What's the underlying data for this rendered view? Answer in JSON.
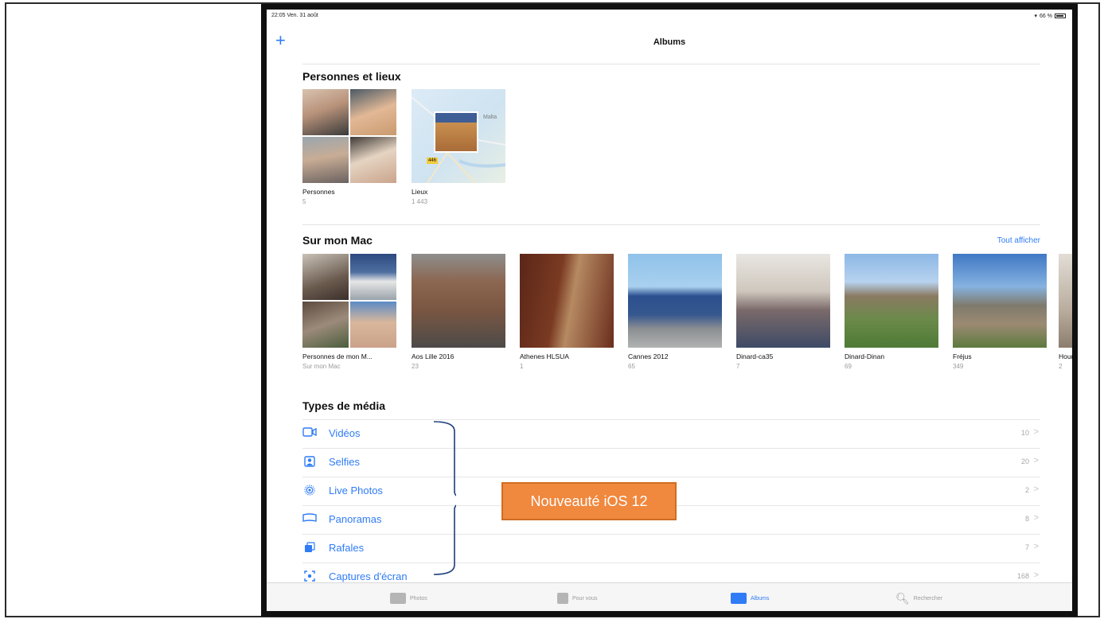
{
  "status_bar": {
    "time": "22:05  Ven. 31 août",
    "battery": "66 %"
  },
  "nav": {
    "title": "Albums",
    "add_symbol": "+"
  },
  "people_places": {
    "title": "Personnes et lieux",
    "albums": [
      {
        "name": "Personnes",
        "count": "5"
      },
      {
        "name": "Lieux",
        "count": "1 443",
        "map_label": "Malta",
        "pin_count": "446"
      }
    ]
  },
  "my_mac": {
    "title": "Sur mon Mac",
    "see_all": "Tout afficher",
    "albums": [
      {
        "name": "Personnes de mon M...",
        "count": "Sur mon Mac"
      },
      {
        "name": "Aos Lille 2016",
        "count": "23"
      },
      {
        "name": "Athenes HLSUA",
        "count": "1"
      },
      {
        "name": "Cannes 2012",
        "count": "65"
      },
      {
        "name": "Dinard-ca35",
        "count": "7"
      },
      {
        "name": "Dinard-Dinan",
        "count": "69"
      },
      {
        "name": "Fréjus",
        "count": "349"
      },
      {
        "name": "Hour",
        "count": "2"
      }
    ]
  },
  "media_types": {
    "title": "Types de média",
    "items": [
      {
        "label": "Vidéos",
        "count": "10",
        "icon": "video-icon"
      },
      {
        "label": "Selfies",
        "count": "20",
        "icon": "selfie-icon"
      },
      {
        "label": "Live Photos",
        "count": "2",
        "icon": "live-photo-icon"
      },
      {
        "label": "Panoramas",
        "count": "8",
        "icon": "panorama-icon"
      },
      {
        "label": "Rafales",
        "count": "7",
        "icon": "burst-icon"
      },
      {
        "label": "Captures d'écran",
        "count": "168",
        "icon": "screenshot-icon"
      }
    ],
    "chevron": ">"
  },
  "callout": {
    "text": "Nouveauté iOS 12",
    "color": "#f0883e"
  },
  "tab_bar": {
    "tabs": [
      {
        "label": "Photos",
        "icon": "photos-tab-icon"
      },
      {
        "label": "Pour vous",
        "icon": "for-you-tab-icon"
      },
      {
        "label": "Albums",
        "icon": "albums-tab-icon",
        "active": true
      },
      {
        "label": "Rechercher",
        "icon": "search-tab-icon"
      }
    ]
  },
  "colors": {
    "accent": "#2f7cf6"
  }
}
